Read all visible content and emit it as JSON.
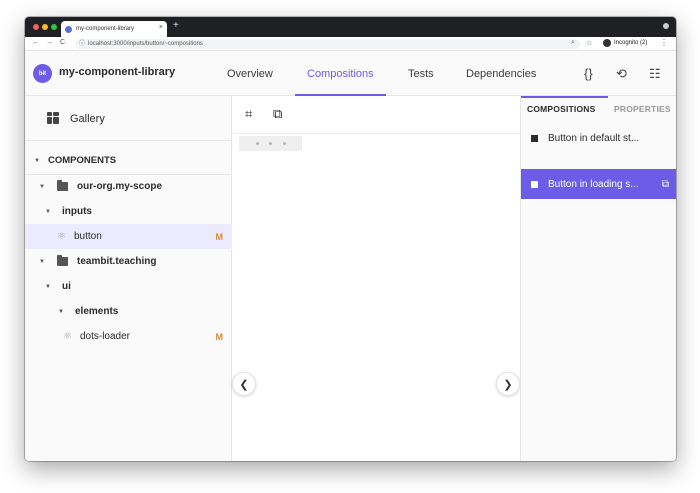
{
  "browser": {
    "tab_title": "my-component-library",
    "tab_close": "×",
    "new_tab": "+",
    "url": "localhost:3000/inputs/button/~compositions",
    "incognito_label": "Incognito (2)",
    "back": "←",
    "forward": "→",
    "reload": "C",
    "menu": "⋮"
  },
  "header": {
    "logo_text": "bit",
    "scope_name": "my-component-library",
    "tabs": [
      {
        "label": "Overview"
      },
      {
        "label": "Compositions"
      },
      {
        "label": "Tests"
      },
      {
        "label": "Dependencies"
      }
    ],
    "active_tab": "Compositions",
    "icons": {
      "code": "{}",
      "history": "⟲",
      "settings": "☷"
    }
  },
  "sidebar": {
    "gallery_label": "Gallery",
    "components_heading": "COMPONENTS",
    "tree": [
      {
        "label": "our-org.my-scope",
        "kind": "scope"
      },
      {
        "label": "inputs",
        "kind": "namespace"
      },
      {
        "label": "button",
        "kind": "component",
        "badge": "M",
        "selected": true
      },
      {
        "label": "teambit.teaching",
        "kind": "scope"
      },
      {
        "label": "ui",
        "kind": "namespace"
      },
      {
        "label": "elements",
        "kind": "namespace"
      },
      {
        "label": "dots-loader",
        "kind": "component",
        "badge": "M",
        "selected": false
      }
    ]
  },
  "right_panel": {
    "tabs": [
      {
        "label": "COMPOSITIONS"
      },
      {
        "label": "PROPERTIES"
      }
    ],
    "compositions": [
      {
        "label": "Button in default st..."
      },
      {
        "label": "Button in loading s..."
      }
    ],
    "active_composition": 1
  },
  "colors": {
    "accent": "#6c5ce7",
    "badge": "#e0892d",
    "selected_row": "#eceaff"
  }
}
